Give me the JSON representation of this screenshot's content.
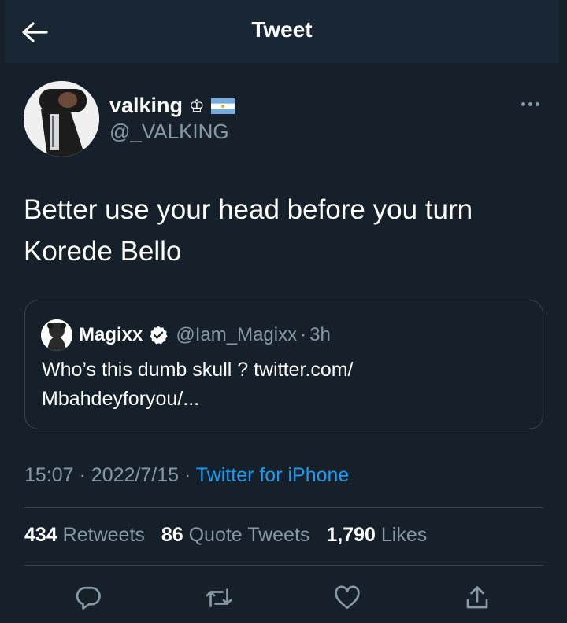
{
  "header": {
    "title": "Tweet"
  },
  "author": {
    "display_name": "valking",
    "crown_glyph": "♔",
    "handle": "@_VALKING"
  },
  "tweet": {
    "text": "Better use your head before you turn Korede Bello"
  },
  "quote": {
    "name": "Magixx",
    "handle": "@Iam_Magixx",
    "separator": "·",
    "time": "3h",
    "text": "Who’s this dumb skull ? twitter.com/ Mbahdeyforyou/..."
  },
  "meta": {
    "time": "15:07",
    "separator": "·",
    "date": "2022/7/15",
    "source": "Twitter for iPhone"
  },
  "stats": {
    "retweets": {
      "count": "434",
      "label": "Retweets"
    },
    "quotes": {
      "count": "86",
      "label": "Quote Tweets"
    },
    "likes": {
      "count": "1,790",
      "label": "Likes"
    }
  },
  "colors": {
    "background": "#15202b",
    "header": "#192734",
    "secondary_text": "#8899a6",
    "accent": "#1d9bf0",
    "divider": "#38444d"
  },
  "icons": [
    "back-arrow-icon",
    "crown-icon",
    "argentina-flag-icon",
    "more-icon",
    "verified-icon",
    "reply-icon",
    "retweet-icon",
    "like-icon",
    "share-icon"
  ]
}
